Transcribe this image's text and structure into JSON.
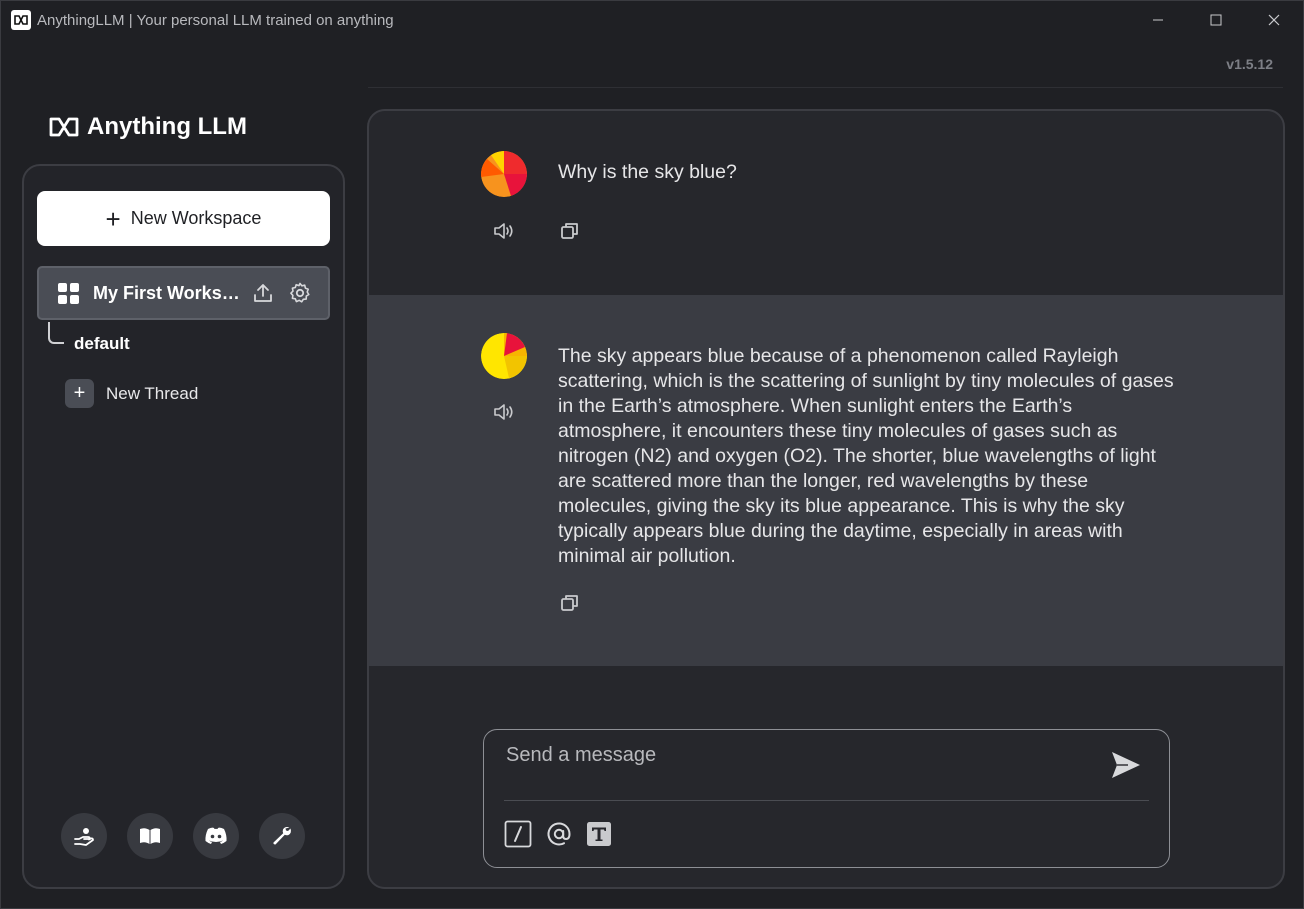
{
  "window": {
    "title": "AnythingLLM | Your personal LLM trained on anything",
    "controls": [
      "minimize-icon",
      "maximize-icon",
      "close-icon"
    ]
  },
  "version": "v1.5.12",
  "logo": {
    "text": "Anything LLM"
  },
  "sidebar": {
    "new_workspace_label": "New Workspace",
    "workspaces": [
      {
        "name": "My First Workspace",
        "threads": [
          {
            "name": "default"
          }
        ]
      }
    ],
    "new_thread_label": "New Thread",
    "footer_icons": [
      "community-hub-icon",
      "docs-book-icon",
      "discord-icon",
      "settings-wrench-icon"
    ]
  },
  "chat": {
    "messages": [
      {
        "role": "user",
        "text": "Why is the sky blue?"
      },
      {
        "role": "assistant",
        "text": "The sky appears blue because of a phenomenon called Rayleigh scattering, which is the scattering of sunlight by tiny molecules of gases in the Earth’s atmosphere. When sunlight enters the Earth’s atmosphere, it encounters these tiny molecules of gases such as nitrogen (N2) and oxygen (O2). The shorter, blue wavelengths of light are scattered more than the longer, red wavelengths by these molecules, giving the sky its blue appearance. This is why the sky typically appears blue during the daytime, especially in areas with minimal air pollution."
      }
    ]
  },
  "composer": {
    "placeholder": "Send a message",
    "value": "",
    "tools": [
      "slash-command-icon",
      "mention-at-icon",
      "text-size-icon"
    ]
  },
  "colors": {
    "background": "#1f2024",
    "panel": "#26272c",
    "assistant_row": "#3a3c43",
    "workspace_active": "#4a4d55",
    "accent_white": "#ffffff"
  }
}
